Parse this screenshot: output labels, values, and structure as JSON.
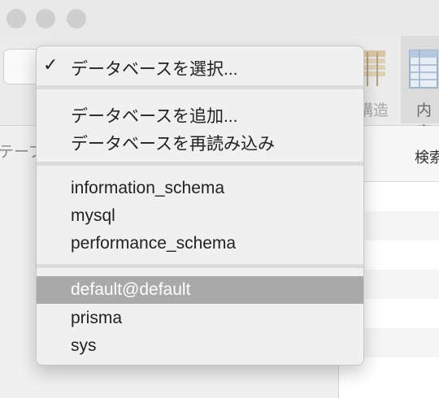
{
  "toolbar": {
    "structure_label": "構造",
    "content_label": "内容"
  },
  "left_panel": {
    "header_label": "テーブ"
  },
  "right_panel": {
    "search_label": "検索"
  },
  "menu": {
    "items": [
      {
        "label": "データベースを選択...",
        "checked": true
      },
      {
        "label": "データベースを追加..."
      },
      {
        "label": "データベースを再読み込み"
      },
      {
        "label": "information_schema"
      },
      {
        "label": "mysql"
      },
      {
        "label": "performance_schema"
      },
      {
        "label": "default@default",
        "highlighted": true
      },
      {
        "label": "prisma"
      },
      {
        "label": "sys"
      }
    ],
    "check_glyph": "✓"
  },
  "colors": {
    "highlight": "#a9a9a9",
    "menu_bg": "#f0f0f0",
    "separator": "#dcdcdc"
  }
}
